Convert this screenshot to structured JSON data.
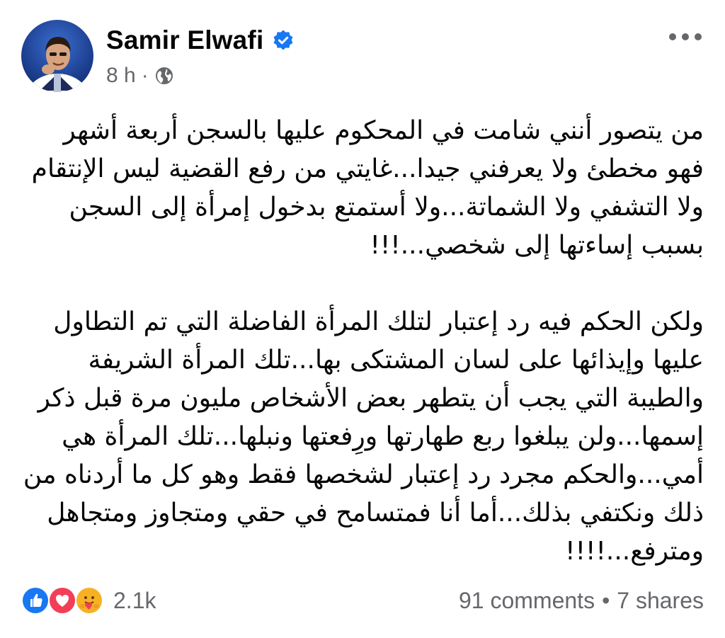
{
  "post": {
    "author": "Samir Elwafi",
    "verified": true,
    "time": "8 h",
    "separator": "·",
    "audience_icon": "globe-icon",
    "more_icon": "more-options-icon",
    "paragraphs": [
      "من يتصور أنني شامت في المحكوم عليها بالسجن أربعة أشهر فهو مخطئ ولا يعرفني جيدا...غايتي من رفع القضية ليس الإنتقام ولا التشفي ولا الشماتة...ولا أستمتع بدخول إمرأة إلى السجن بسبب إساءتها إلى شخصي...!!!",
      "ولكن الحكم فيه رد إعتبار لتلك المرأة الفاضلة التي تم التطاول عليها وإيذائها على لسان المشتكى بها...تلك المرأة الشريفة والطيبة التي يجب أن يتطهر بعض الأشخاص مليون مرة قبل ذكر إسمها...ولن يبلغوا ربع طهارتها ورِفعتها ونبلها...تلك المرأة هي أمي...والحكم مجرد رد إعتبار لشخصها فقط وهو كل ما أردناه من ذلك ونكتفي بذلك...أما أنا فمتسامح في حقي ومتجاوز ومتجاهل ومترفع...!!!!"
    ]
  },
  "footer": {
    "reaction_icons": [
      "like-icon",
      "love-icon",
      "care-icon"
    ],
    "reaction_count": "2.1k",
    "comments": "91 comments",
    "dot": "•",
    "shares": "7 shares"
  },
  "colors": {
    "text": "#050505",
    "secondary_text": "#65676b",
    "verified_blue": "#1877f2",
    "like_blue": "#1877f2",
    "love_red": "#f33e58",
    "care_yellow": "#f7b125"
  }
}
